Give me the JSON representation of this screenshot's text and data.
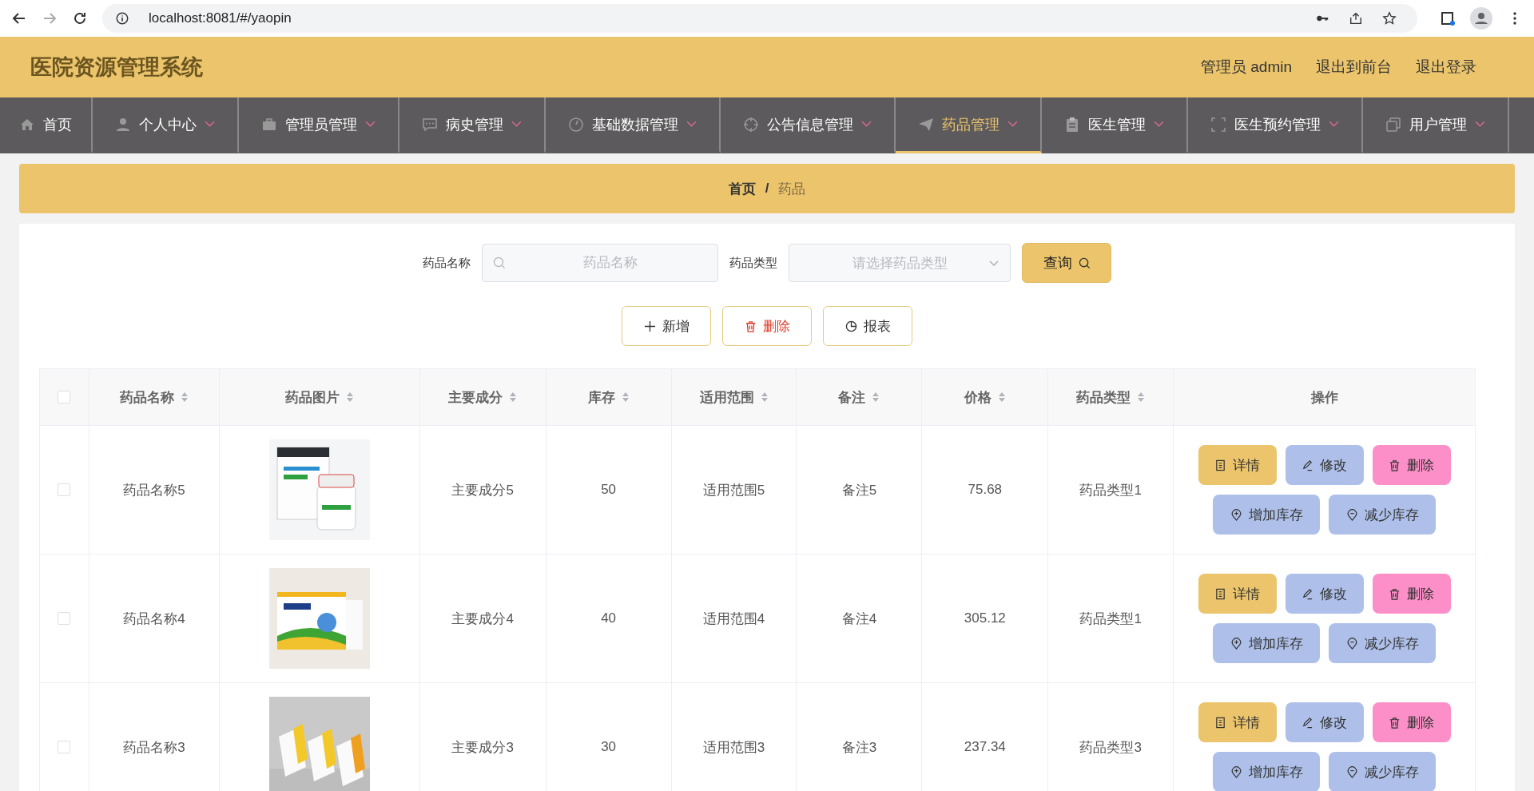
{
  "browser": {
    "url": "localhost:8081/#/yaopin"
  },
  "header": {
    "title": "医院资源管理系统",
    "links": [
      "管理员 admin",
      "退出到前台",
      "退出登录"
    ]
  },
  "nav": [
    {
      "label": "首页",
      "dropdown": false,
      "selected": false
    },
    {
      "label": "个人中心",
      "dropdown": true,
      "selected": false
    },
    {
      "label": "管理员管理",
      "dropdown": true,
      "selected": false
    },
    {
      "label": "病史管理",
      "dropdown": true,
      "selected": false
    },
    {
      "label": "基础数据管理",
      "dropdown": true,
      "selected": false
    },
    {
      "label": "公告信息管理",
      "dropdown": true,
      "selected": false
    },
    {
      "label": "药品管理",
      "dropdown": true,
      "selected": true
    },
    {
      "label": "医生管理",
      "dropdown": true,
      "selected": false
    },
    {
      "label": "医生预约管理",
      "dropdown": true,
      "selected": false
    },
    {
      "label": "用户管理",
      "dropdown": true,
      "selected": false
    }
  ],
  "breadcrumb": {
    "home": "首页",
    "separator": "/",
    "current": "药品"
  },
  "search": {
    "name_label": "药品名称",
    "name_placeholder": "药品名称",
    "type_label": "药品类型",
    "type_placeholder": "请选择药品类型",
    "query": "查询"
  },
  "toolbar": [
    {
      "label": "新增",
      "kind": "add"
    },
    {
      "label": "删除",
      "kind": "delete"
    },
    {
      "label": "报表",
      "kind": "report"
    }
  ],
  "table": {
    "select_all": {
      "checked": false
    },
    "columns": [
      {
        "label": "药品名称",
        "sortable": true
      },
      {
        "label": "药品图片",
        "sortable": true
      },
      {
        "label": "主要成分",
        "sortable": true
      },
      {
        "label": "库存",
        "sortable": true
      },
      {
        "label": "适用范围",
        "sortable": true
      },
      {
        "label": "备注",
        "sortable": true
      },
      {
        "label": "价格",
        "sortable": true
      },
      {
        "label": "药品类型",
        "sortable": true
      },
      {
        "label": "操作",
        "sortable": false
      }
    ],
    "rows": [
      {
        "checked": false,
        "name": "药品名称5",
        "ingredient": "主要成分5",
        "stock": "50",
        "scope": "适用范围5",
        "note": "备注5",
        "price": "75.68",
        "type": "药品类型1",
        "actions": [
          {
            "label": "详情",
            "kind": "detail"
          },
          {
            "label": "修改",
            "kind": "edit"
          },
          {
            "label": "删除",
            "kind": "delete"
          },
          {
            "label": "增加库存",
            "kind": "add-stock"
          },
          {
            "label": "减少库存",
            "kind": "reduce-stock"
          }
        ]
      },
      {
        "checked": false,
        "name": "药品名称4",
        "ingredient": "主要成分4",
        "stock": "40",
        "scope": "适用范围4",
        "note": "备注4",
        "price": "305.12",
        "type": "药品类型1",
        "actions": [
          {
            "label": "详情",
            "kind": "detail"
          },
          {
            "label": "修改",
            "kind": "edit"
          },
          {
            "label": "删除",
            "kind": "delete"
          },
          {
            "label": "增加库存",
            "kind": "add-stock"
          },
          {
            "label": "减少库存",
            "kind": "reduce-stock"
          }
        ]
      },
      {
        "checked": false,
        "name": "药品名称3",
        "ingredient": "主要成分3",
        "stock": "30",
        "scope": "适用范围3",
        "note": "备注3",
        "price": "237.34",
        "type": "药品类型3",
        "actions": [
          {
            "label": "详情",
            "kind": "detail"
          },
          {
            "label": "修改",
            "kind": "edit"
          },
          {
            "label": "删除",
            "kind": "delete"
          },
          {
            "label": "增加库存",
            "kind": "add-stock"
          },
          {
            "label": "减少库存",
            "kind": "reduce-stock"
          }
        ]
      }
    ]
  }
}
